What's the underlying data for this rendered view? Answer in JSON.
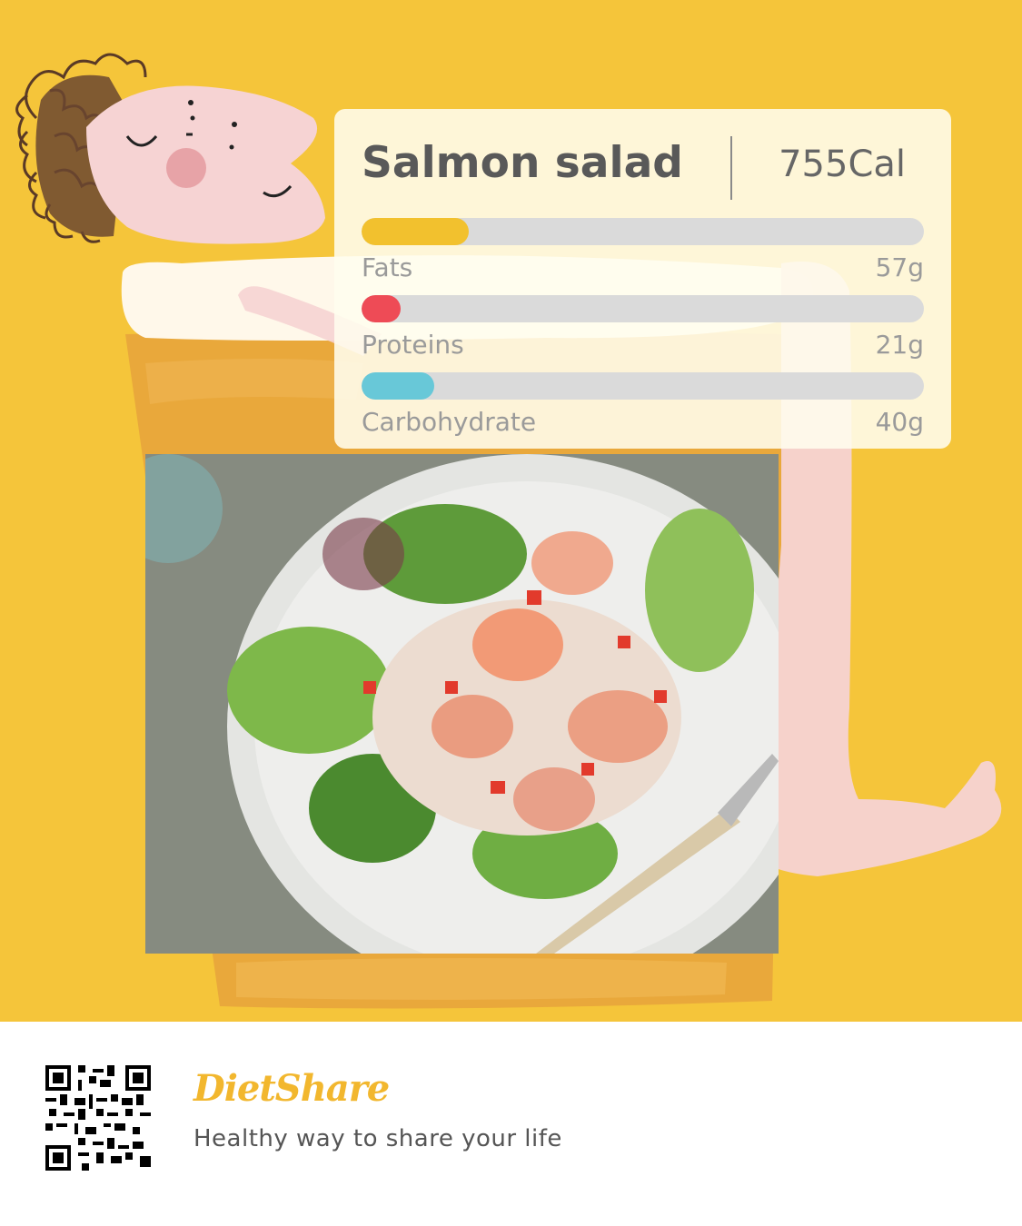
{
  "colors": {
    "background": "#f5c53a",
    "cup": "#e9a83b",
    "skin": "#f6d3d3",
    "hair": "#5a3a26",
    "fats": "#f2c12e",
    "proteins": "#ee4b56",
    "carbohydrate": "#68c8d8",
    "bar_track": "#dadada",
    "brand": "#f2b72e"
  },
  "card": {
    "title": "Salmon salad",
    "calories": "755Cal",
    "nutrients": [
      {
        "label": "Fats",
        "value": "57g",
        "fill_fraction": 0.19,
        "color": "#f2c12e"
      },
      {
        "label": "Proteins",
        "value": "21g",
        "fill_fraction": 0.07,
        "color": "#ee4b56"
      },
      {
        "label": "Carbohydrate",
        "value": "40g",
        "fill_fraction": 0.13,
        "color": "#68c8d8"
      }
    ]
  },
  "photo": {
    "icon": "salmon-salad-photo"
  },
  "footer": {
    "brand": "DietShare",
    "tagline": "Healthy way to share your life",
    "qr_icon": "qr-code-icon"
  }
}
